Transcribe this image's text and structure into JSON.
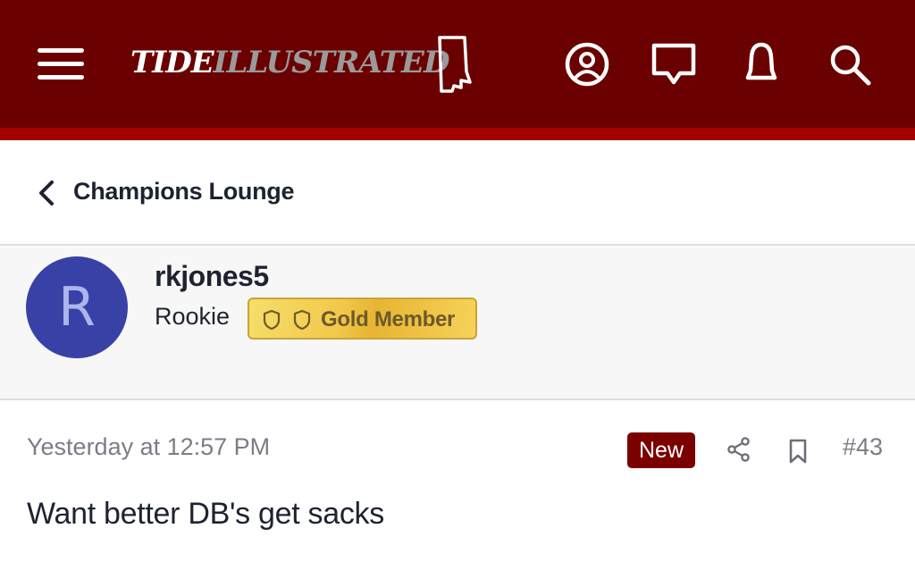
{
  "header": {
    "logo_part1": "TIDE",
    "logo_part2": "ILLUSTRATED",
    "colors": {
      "bar": "#6b0000",
      "stripe": "#a30000"
    },
    "icons": [
      "menu-icon",
      "account-icon",
      "messages-icon",
      "alerts-icon",
      "search-icon"
    ]
  },
  "breadcrumb": {
    "icon": "chevron-left-icon",
    "label": "Champions Lounge"
  },
  "user": {
    "avatar_letter": "R",
    "avatar_color": "#3741a6",
    "username": "rkjones5",
    "title": "Rookie",
    "badge_label": "Gold Member",
    "badge_icons": [
      "shield-icon",
      "shield-icon"
    ]
  },
  "post": {
    "timestamp": "Yesterday at 12:57 PM",
    "new_label": "New",
    "new_color": "#7b0000",
    "actions": [
      "share-icon",
      "bookmark-icon"
    ],
    "number": "#43",
    "body": "Want better DB's get sacks"
  }
}
